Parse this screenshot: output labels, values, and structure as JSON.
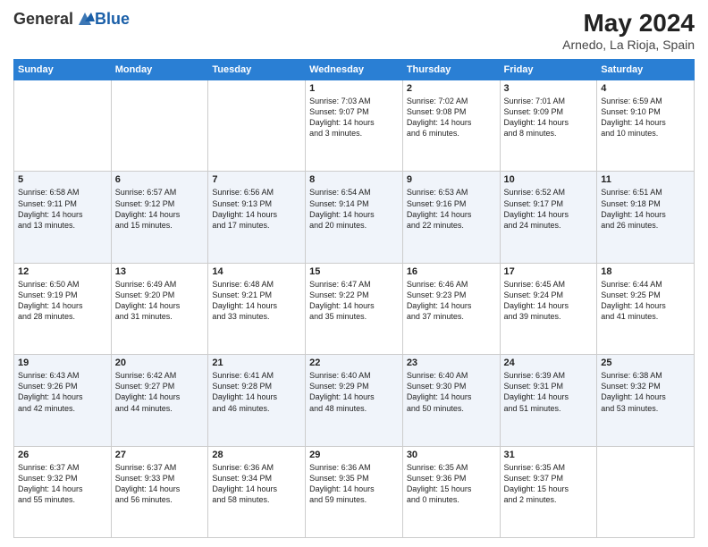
{
  "header": {
    "logo_general": "General",
    "logo_blue": "Blue",
    "month_year": "May 2024",
    "location": "Arnedo, La Rioja, Spain"
  },
  "weekdays": [
    "Sunday",
    "Monday",
    "Tuesday",
    "Wednesday",
    "Thursday",
    "Friday",
    "Saturday"
  ],
  "weeks": [
    [
      {
        "day": "",
        "lines": []
      },
      {
        "day": "",
        "lines": []
      },
      {
        "day": "",
        "lines": []
      },
      {
        "day": "1",
        "lines": [
          "Sunrise: 7:03 AM",
          "Sunset: 9:07 PM",
          "Daylight: 14 hours",
          "and 3 minutes."
        ]
      },
      {
        "day": "2",
        "lines": [
          "Sunrise: 7:02 AM",
          "Sunset: 9:08 PM",
          "Daylight: 14 hours",
          "and 6 minutes."
        ]
      },
      {
        "day": "3",
        "lines": [
          "Sunrise: 7:01 AM",
          "Sunset: 9:09 PM",
          "Daylight: 14 hours",
          "and 8 minutes."
        ]
      },
      {
        "day": "4",
        "lines": [
          "Sunrise: 6:59 AM",
          "Sunset: 9:10 PM",
          "Daylight: 14 hours",
          "and 10 minutes."
        ]
      }
    ],
    [
      {
        "day": "5",
        "lines": [
          "Sunrise: 6:58 AM",
          "Sunset: 9:11 PM",
          "Daylight: 14 hours",
          "and 13 minutes."
        ]
      },
      {
        "day": "6",
        "lines": [
          "Sunrise: 6:57 AM",
          "Sunset: 9:12 PM",
          "Daylight: 14 hours",
          "and 15 minutes."
        ]
      },
      {
        "day": "7",
        "lines": [
          "Sunrise: 6:56 AM",
          "Sunset: 9:13 PM",
          "Daylight: 14 hours",
          "and 17 minutes."
        ]
      },
      {
        "day": "8",
        "lines": [
          "Sunrise: 6:54 AM",
          "Sunset: 9:14 PM",
          "Daylight: 14 hours",
          "and 20 minutes."
        ]
      },
      {
        "day": "9",
        "lines": [
          "Sunrise: 6:53 AM",
          "Sunset: 9:16 PM",
          "Daylight: 14 hours",
          "and 22 minutes."
        ]
      },
      {
        "day": "10",
        "lines": [
          "Sunrise: 6:52 AM",
          "Sunset: 9:17 PM",
          "Daylight: 14 hours",
          "and 24 minutes."
        ]
      },
      {
        "day": "11",
        "lines": [
          "Sunrise: 6:51 AM",
          "Sunset: 9:18 PM",
          "Daylight: 14 hours",
          "and 26 minutes."
        ]
      }
    ],
    [
      {
        "day": "12",
        "lines": [
          "Sunrise: 6:50 AM",
          "Sunset: 9:19 PM",
          "Daylight: 14 hours",
          "and 28 minutes."
        ]
      },
      {
        "day": "13",
        "lines": [
          "Sunrise: 6:49 AM",
          "Sunset: 9:20 PM",
          "Daylight: 14 hours",
          "and 31 minutes."
        ]
      },
      {
        "day": "14",
        "lines": [
          "Sunrise: 6:48 AM",
          "Sunset: 9:21 PM",
          "Daylight: 14 hours",
          "and 33 minutes."
        ]
      },
      {
        "day": "15",
        "lines": [
          "Sunrise: 6:47 AM",
          "Sunset: 9:22 PM",
          "Daylight: 14 hours",
          "and 35 minutes."
        ]
      },
      {
        "day": "16",
        "lines": [
          "Sunrise: 6:46 AM",
          "Sunset: 9:23 PM",
          "Daylight: 14 hours",
          "and 37 minutes."
        ]
      },
      {
        "day": "17",
        "lines": [
          "Sunrise: 6:45 AM",
          "Sunset: 9:24 PM",
          "Daylight: 14 hours",
          "and 39 minutes."
        ]
      },
      {
        "day": "18",
        "lines": [
          "Sunrise: 6:44 AM",
          "Sunset: 9:25 PM",
          "Daylight: 14 hours",
          "and 41 minutes."
        ]
      }
    ],
    [
      {
        "day": "19",
        "lines": [
          "Sunrise: 6:43 AM",
          "Sunset: 9:26 PM",
          "Daylight: 14 hours",
          "and 42 minutes."
        ]
      },
      {
        "day": "20",
        "lines": [
          "Sunrise: 6:42 AM",
          "Sunset: 9:27 PM",
          "Daylight: 14 hours",
          "and 44 minutes."
        ]
      },
      {
        "day": "21",
        "lines": [
          "Sunrise: 6:41 AM",
          "Sunset: 9:28 PM",
          "Daylight: 14 hours",
          "and 46 minutes."
        ]
      },
      {
        "day": "22",
        "lines": [
          "Sunrise: 6:40 AM",
          "Sunset: 9:29 PM",
          "Daylight: 14 hours",
          "and 48 minutes."
        ]
      },
      {
        "day": "23",
        "lines": [
          "Sunrise: 6:40 AM",
          "Sunset: 9:30 PM",
          "Daylight: 14 hours",
          "and 50 minutes."
        ]
      },
      {
        "day": "24",
        "lines": [
          "Sunrise: 6:39 AM",
          "Sunset: 9:31 PM",
          "Daylight: 14 hours",
          "and 51 minutes."
        ]
      },
      {
        "day": "25",
        "lines": [
          "Sunrise: 6:38 AM",
          "Sunset: 9:32 PM",
          "Daylight: 14 hours",
          "and 53 minutes."
        ]
      }
    ],
    [
      {
        "day": "26",
        "lines": [
          "Sunrise: 6:37 AM",
          "Sunset: 9:32 PM",
          "Daylight: 14 hours",
          "and 55 minutes."
        ]
      },
      {
        "day": "27",
        "lines": [
          "Sunrise: 6:37 AM",
          "Sunset: 9:33 PM",
          "Daylight: 14 hours",
          "and 56 minutes."
        ]
      },
      {
        "day": "28",
        "lines": [
          "Sunrise: 6:36 AM",
          "Sunset: 9:34 PM",
          "Daylight: 14 hours",
          "and 58 minutes."
        ]
      },
      {
        "day": "29",
        "lines": [
          "Sunrise: 6:36 AM",
          "Sunset: 9:35 PM",
          "Daylight: 14 hours",
          "and 59 minutes."
        ]
      },
      {
        "day": "30",
        "lines": [
          "Sunrise: 6:35 AM",
          "Sunset: 9:36 PM",
          "Daylight: 15 hours",
          "and 0 minutes."
        ]
      },
      {
        "day": "31",
        "lines": [
          "Sunrise: 6:35 AM",
          "Sunset: 9:37 PM",
          "Daylight: 15 hours",
          "and 2 minutes."
        ]
      },
      {
        "day": "",
        "lines": []
      }
    ]
  ]
}
